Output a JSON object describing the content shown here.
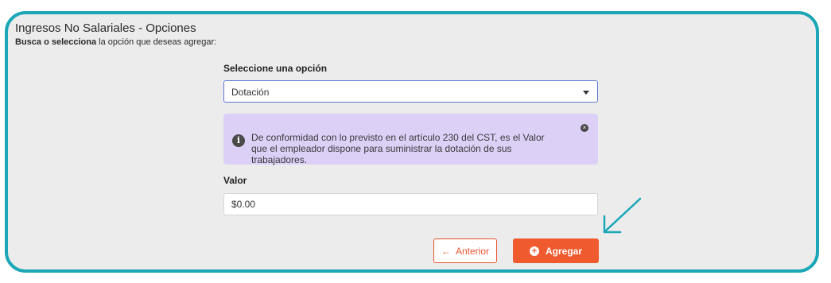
{
  "panel": {
    "title": "Ingresos No Salariales - Opciones",
    "subtitle_bold": "Busca o selecciona",
    "subtitle_rest": " la opción que deseas agregar:"
  },
  "select": {
    "label": "Seleccione una opción",
    "value": "Dotación"
  },
  "alert": {
    "text": "De conformidad con lo previsto en el artículo 230 del CST, es el Valor que el empleador dispone para suministrar la dotación de sus trabajadores.",
    "info_icon": "i",
    "close_icon": "×"
  },
  "value_field": {
    "label": "Valor",
    "value": "$0.00"
  },
  "buttons": {
    "previous": "Anterior",
    "add": "Agregar"
  },
  "colors": {
    "frame": "#1ba7b8",
    "primary": "#ef5a2e",
    "alert_bg": "#dcd0f7",
    "panel_bg": "#ececec"
  }
}
